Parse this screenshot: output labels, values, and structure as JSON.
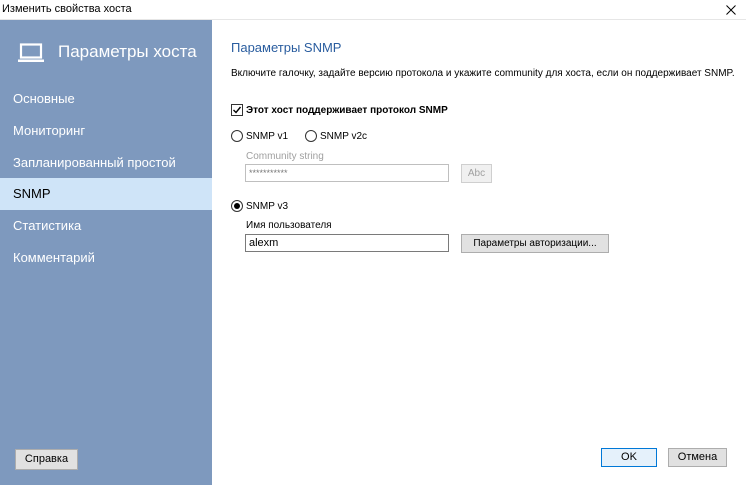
{
  "window": {
    "title": "Изменить свойства хоста"
  },
  "sidebar": {
    "header_title": "Параметры хоста",
    "items": [
      {
        "label": "Основные"
      },
      {
        "label": "Мониторинг"
      },
      {
        "label": "Запланированный простой"
      },
      {
        "label": "SNMP",
        "active": true
      },
      {
        "label": "Статистика"
      },
      {
        "label": "Комментарий"
      }
    ],
    "help_button": "Справка"
  },
  "main": {
    "section_title": "Параметры SNMP",
    "description": "Включите галочку, задайте версию протокола и укажите community для хоста,  если он поддерживает SNMP.",
    "snmp_checkbox_label": "Этот хост поддерживает протокол SNMP",
    "snmp_checkbox_checked": true,
    "radio_v1": "SNMP v1",
    "radio_v2c": "SNMP v2c",
    "community_label": "Community string",
    "community_value": "***********",
    "abc_button": "Abc",
    "radio_v3": "SNMP v3",
    "username_label": "Имя пользователя",
    "username_value": "alexm",
    "auth_button": "Параметры авторизации...",
    "ok_button": "OK",
    "cancel_button": "Отмена"
  },
  "colors": {
    "sidebar_bg": "#7e99be",
    "active_item_bg": "#cfe4f8",
    "title_accent": "#2a5d9f"
  }
}
